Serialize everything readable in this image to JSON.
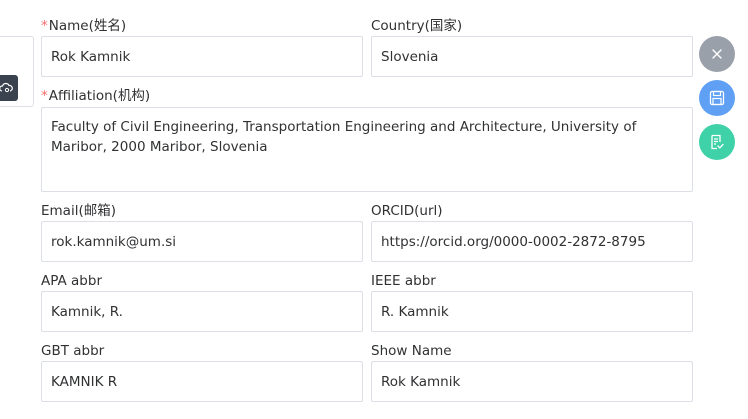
{
  "form": {
    "name": {
      "label": "Name(姓名)",
      "value": "Rok Kamnik",
      "required": true
    },
    "country": {
      "label": "Country(国家)",
      "value": "Slovenia"
    },
    "affiliation": {
      "label": "Affiliation(机构)",
      "value": "Faculty of Civil Engineering, Transportation Engineering and Architecture, University of Maribor, 2000 Maribor, Slovenia",
      "required": true
    },
    "email": {
      "label": "Email(邮箱)",
      "value": "rok.kamnik@um.si"
    },
    "orcid": {
      "label": "ORCID(url)",
      "value": "https://orcid.org/0000-0002-2872-8795"
    },
    "apa": {
      "label": "APA abbr",
      "value": "Kamnik, R."
    },
    "ieee": {
      "label": "IEEE abbr",
      "value": "R. Kamnik"
    },
    "gbt": {
      "label": "GBT abbr",
      "value": "KAMNIK R"
    },
    "show_name": {
      "label": "Show Name",
      "value": "Rok Kamnik"
    }
  },
  "required_marker": "*",
  "actions": [
    {
      "icon": "close-icon",
      "color": "#9aa0a9"
    },
    {
      "icon": "save-icon",
      "color": "#5fa0f5"
    },
    {
      "icon": "document-check-icon",
      "color": "#3fd1a8"
    }
  ],
  "left_panel": {
    "icon": "cloud-icon",
    "color": "#3a4250"
  }
}
